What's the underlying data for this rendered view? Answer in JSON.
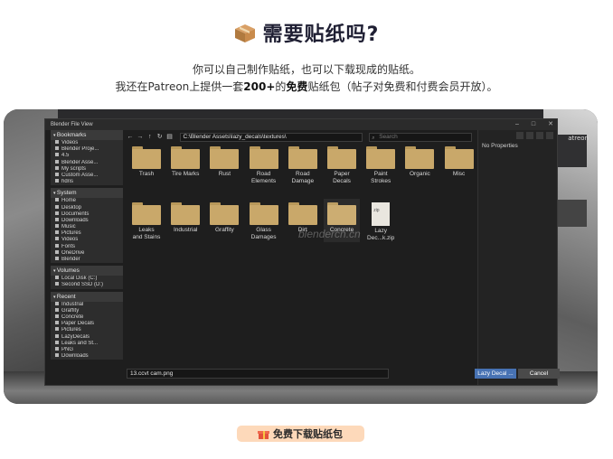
{
  "header": {
    "title": "需要贴纸吗?",
    "line1": "你可以自己制作贴纸，也可以下载现成的贴纸。",
    "line2_prefix": "我还在Patreon上提供一套",
    "line2_count": "200+",
    "line2_mid": "的",
    "line2_free": "免费",
    "line2_suffix": "贴纸包（帖子对免费和付费会员开放）。"
  },
  "file_view": {
    "window_title": "Blender File View",
    "path": "C:\\Blender Assets\\lazy_decals\\textures\\",
    "search_placeholder": "Search",
    "no_properties": "No Properties",
    "filename": "13.ccvt cam.png",
    "primary_button": "Lazy Decal ...",
    "cancel_button": "Cancel",
    "watermark": "blendercn.cn",
    "right_edge_text": "atreon",
    "sidebar": [
      {
        "heading": "Bookmarks",
        "items": [
          "Videos",
          "Blender Proje...",
          "4.5",
          "Blender Asse...",
          "My scripts",
          "Custom Asse...",
          "hdris"
        ]
      },
      {
        "heading": "System",
        "items": [
          "Home",
          "Desktop",
          "Documents",
          "Downloads",
          "Music",
          "Pictures",
          "Videos",
          "Fonts",
          "OneDrive",
          "Blender"
        ]
      },
      {
        "heading": "Volumes",
        "items": [
          "Local Disk (C:)",
          "Second SSD (D:)"
        ]
      },
      {
        "heading": "Recent",
        "items": [
          "Industrial",
          "Graffity",
          "Concrete",
          "Paper Decals",
          "Pictures",
          "LazyDecals",
          "Leaks and St...",
          "PNG",
          "Downloads"
        ]
      }
    ],
    "folders_row1": [
      "Trash",
      "Tire Marks",
      "Rust",
      "Road\nElements",
      "Road\nDamage",
      "Paper\nDecals",
      "Paint\nStrokes",
      "Organic",
      "Misc"
    ],
    "folders_row2": [
      "Leaks\nand Stains",
      "Industrial",
      "Graffity",
      "Glass\nDamages",
      "Dirt",
      "Concrete"
    ],
    "zip_label": "Lazy\nDec...k.zip"
  },
  "cta": {
    "label": "免费下载贴纸包"
  }
}
